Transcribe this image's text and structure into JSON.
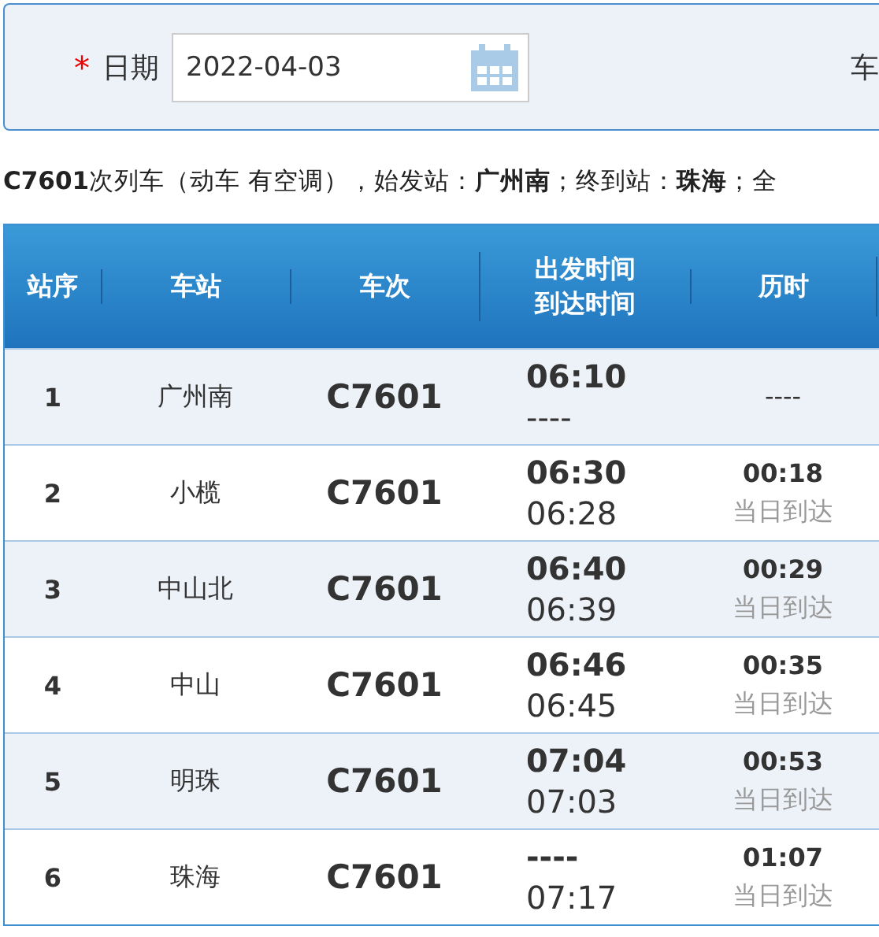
{
  "query_panel": {
    "date_label": {
      "required_mark": "*",
      "text": "日期"
    },
    "date_field": {
      "value": "2022-04-03"
    },
    "next_label": "车"
  },
  "summary": "**C7601**次列车（动车 有空调），始发站：**广州南**；终到站：**珠海**；全",
  "table": {
    "columns": [
      "站序",
      "车站",
      "车次",
      "出发时间到达时间",
      "历时"
    ],
    "rows": [
      {
        "seq": "1",
        "station": "广州南",
        "train": "C7601",
        "depart": "06:10",
        "arrive": "----",
        "duration": "----"
      },
      {
        "seq": "2",
        "station": "小榄",
        "train": "C7601",
        "depart": "06:30",
        "arrive": "06:28",
        "duration": "00:18",
        "day_note": "当日到达"
      },
      {
        "seq": "3",
        "station": "中山北",
        "train": "C7601",
        "depart": "06:40",
        "arrive": "06:39",
        "duration": "00:29",
        "day_note": "当日到达"
      },
      {
        "seq": "4",
        "station": "中山",
        "train": "C7601",
        "depart": "06:46",
        "arrive": "06:45",
        "duration": "00:35",
        "day_note": "当日到达"
      },
      {
        "seq": "5",
        "station": "明珠",
        "train": "C7601",
        "depart": "07:04",
        "arrive": "07:03",
        "duration": "00:53",
        "day_note": "当日到达"
      },
      {
        "seq": "6",
        "station": "珠海",
        "train": "C7601",
        "depart": "----",
        "arrive": "07:17",
        "duration": "01:07",
        "day_note": "当日到达"
      }
    ]
  }
}
